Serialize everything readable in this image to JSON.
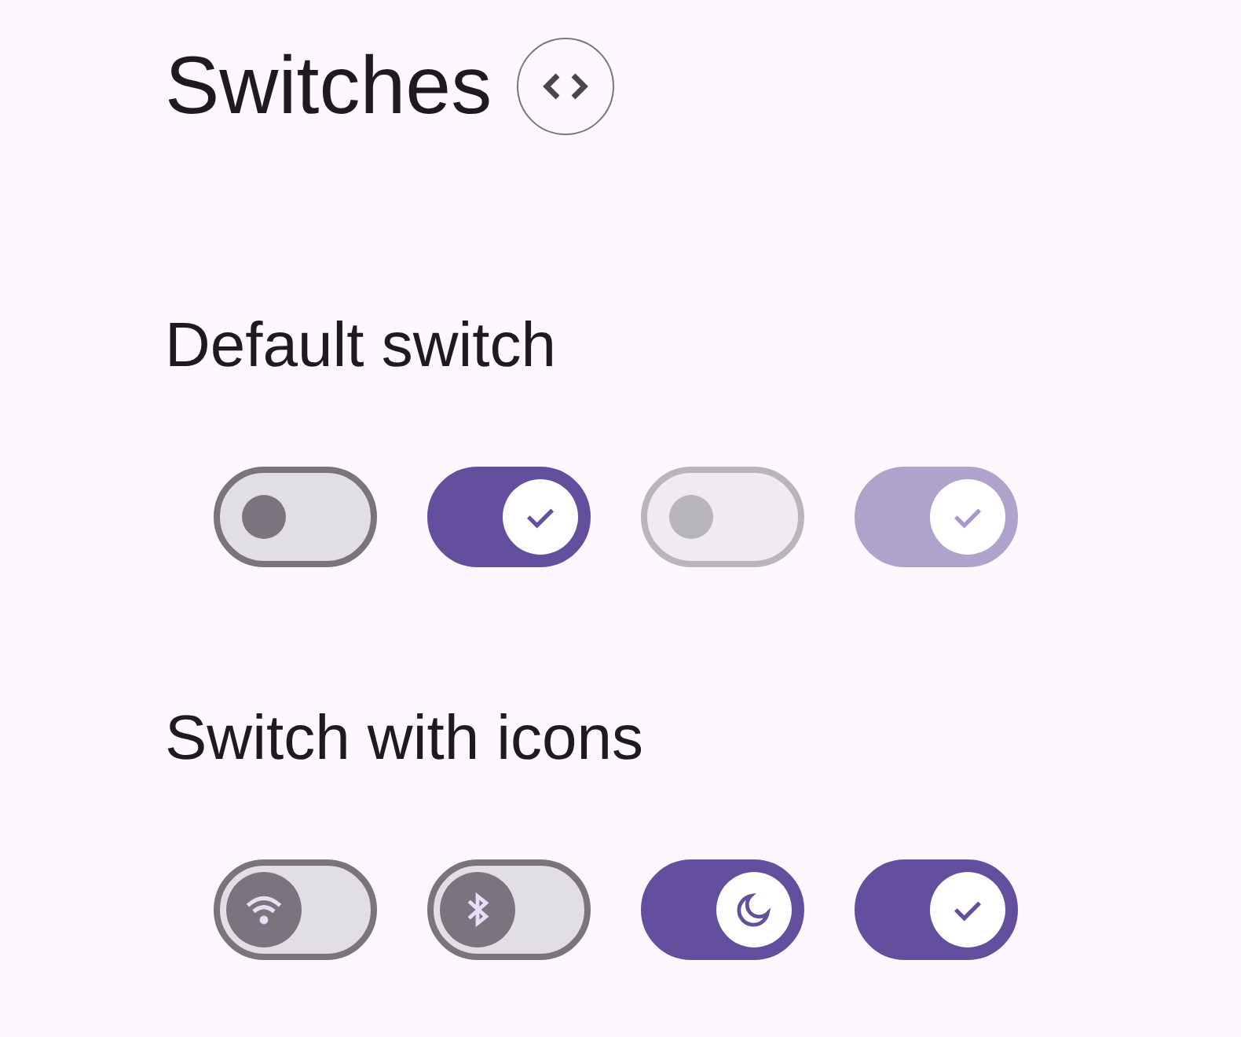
{
  "title": "Switches",
  "sections": [
    {
      "heading": "Default switch",
      "switches": [
        {
          "checked": false,
          "disabled": false,
          "kind": "plain"
        },
        {
          "checked": true,
          "disabled": false,
          "kind": "check"
        },
        {
          "checked": false,
          "disabled": true,
          "kind": "plain"
        },
        {
          "checked": true,
          "disabled": true,
          "kind": "check"
        }
      ]
    },
    {
      "heading": "Switch with icons",
      "switches": [
        {
          "checked": false,
          "disabled": false,
          "kind": "wifi"
        },
        {
          "checked": false,
          "disabled": false,
          "kind": "bluetooth"
        },
        {
          "checked": true,
          "disabled": false,
          "kind": "moon"
        },
        {
          "checked": true,
          "disabled": false,
          "kind": "check"
        }
      ]
    }
  ]
}
